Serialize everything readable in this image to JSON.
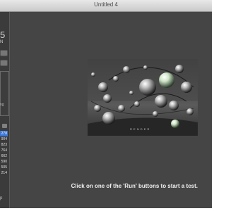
{
  "window": {
    "title": "Untitled 4"
  },
  "sidebar": {
    "logo_number": "5",
    "logo_sub": "N",
    "settings_label": "ng",
    "scores": [
      "278",
      "904",
      "823",
      "764",
      "662",
      "590",
      "505",
      "214"
    ],
    "bottom_label": "p"
  },
  "main": {
    "preview_watermark": "R E N D E R",
    "status_message": "Click on one of the 'Run' buttons to start a test."
  }
}
